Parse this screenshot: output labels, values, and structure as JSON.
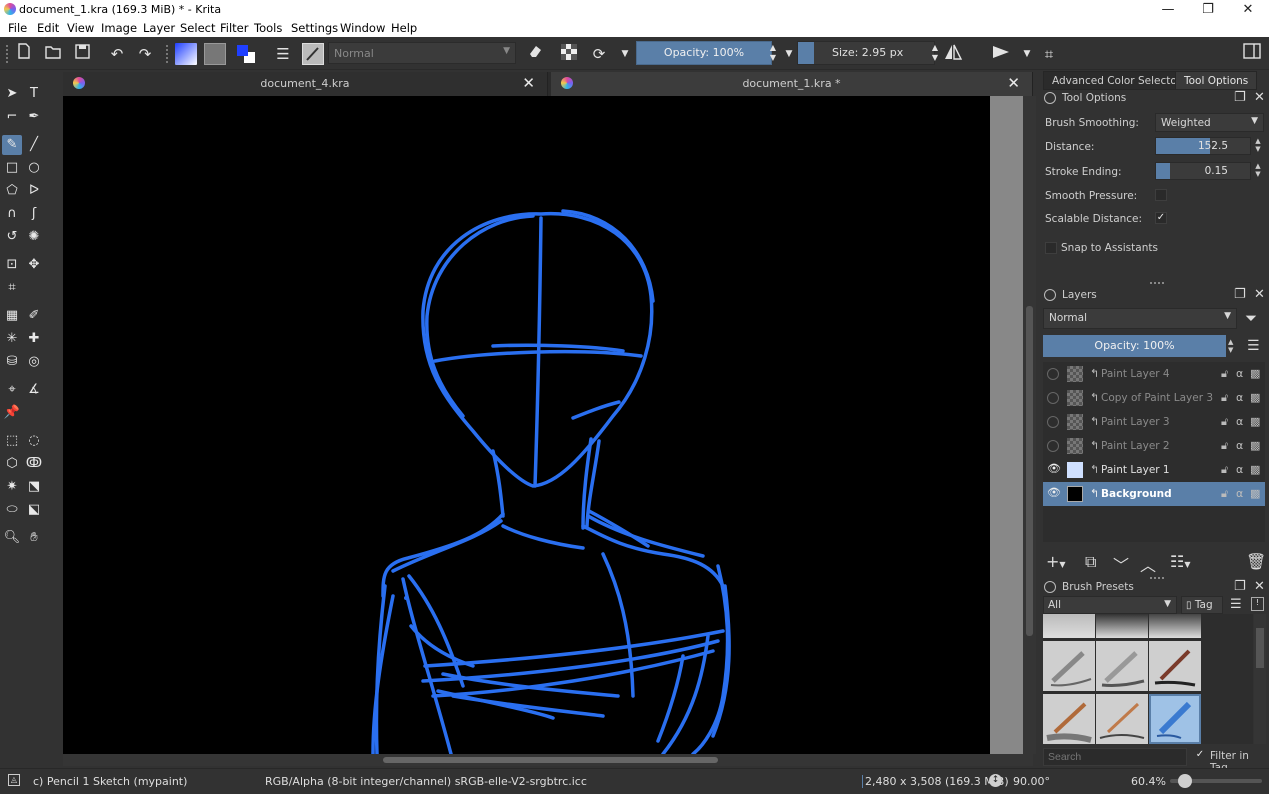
{
  "window": {
    "title": "document_1.kra (169.3 MiB)  * - Krita",
    "minimize": "—",
    "maximize": "❐",
    "close": "✕"
  },
  "menu": [
    "File",
    "Edit",
    "View",
    "Image",
    "Layer",
    "Select",
    "Filter",
    "Tools",
    "Settings",
    "Window",
    "Help"
  ],
  "toolbar": {
    "blend_mode": "Normal",
    "opacity_label": "Opacity: 100%",
    "opacity_fraction": 1.0,
    "size_label": "Size: 2.95 px",
    "colors": {
      "foreground": "#1f3fff",
      "background": "#ffffff",
      "accent": "#5a7fa8"
    }
  },
  "tabs": [
    {
      "label": "document_4.kra",
      "close": "✕"
    },
    {
      "label": "document_1.kra *",
      "close": "✕"
    }
  ],
  "dock_tabs": [
    "Advanced Color Selector",
    "Tool Options"
  ],
  "tool_options": {
    "title": "Tool Options",
    "brush_smoothing_label": "Brush Smoothing:",
    "brush_smoothing_value": "Weighted",
    "distance_label": "Distance:",
    "distance_value": "152.5",
    "stroke_ending_label": "Stroke Ending:",
    "stroke_ending_value": "0.15",
    "smooth_pressure_label": "Smooth Pressure:",
    "smooth_pressure_checked": false,
    "scalable_distance_label": "Scalable Distance:",
    "scalable_distance_check": "✓",
    "snap_label": "Snap to Assistants"
  },
  "layers": {
    "title": "Layers",
    "blend_mode": "Normal",
    "opacity_label": "Opacity:  100%",
    "items": [
      {
        "name": "Paint Layer 4",
        "visible": false,
        "selected": false
      },
      {
        "name": "Copy of Paint Layer 3",
        "visible": false,
        "selected": false
      },
      {
        "name": "Paint Layer 3",
        "visible": false,
        "selected": false
      },
      {
        "name": "Paint Layer 2",
        "visible": false,
        "selected": false
      },
      {
        "name": "Paint Layer 1",
        "visible": true,
        "selected": false
      },
      {
        "name": "Background",
        "visible": true,
        "selected": true
      }
    ]
  },
  "brush_presets": {
    "title": "Brush Presets",
    "filter": "All",
    "tag_label": "Tag",
    "search_placeholder": "Search",
    "filter_in_tag_label": "Filter in Tag",
    "filter_in_tag_check": "✓"
  },
  "status": {
    "brush": "c) Pencil 1 Sketch (mypaint)",
    "color_space": "RGB/Alpha (8-bit integer/channel)  sRGB-elle-V2-srgbtrc.icc",
    "dimensions": "2,480 x 3,508 (169.3 MiB)",
    "rotation": "90.00°",
    "zoom": "60.4%"
  },
  "sketch_color": "#2a6ff0"
}
